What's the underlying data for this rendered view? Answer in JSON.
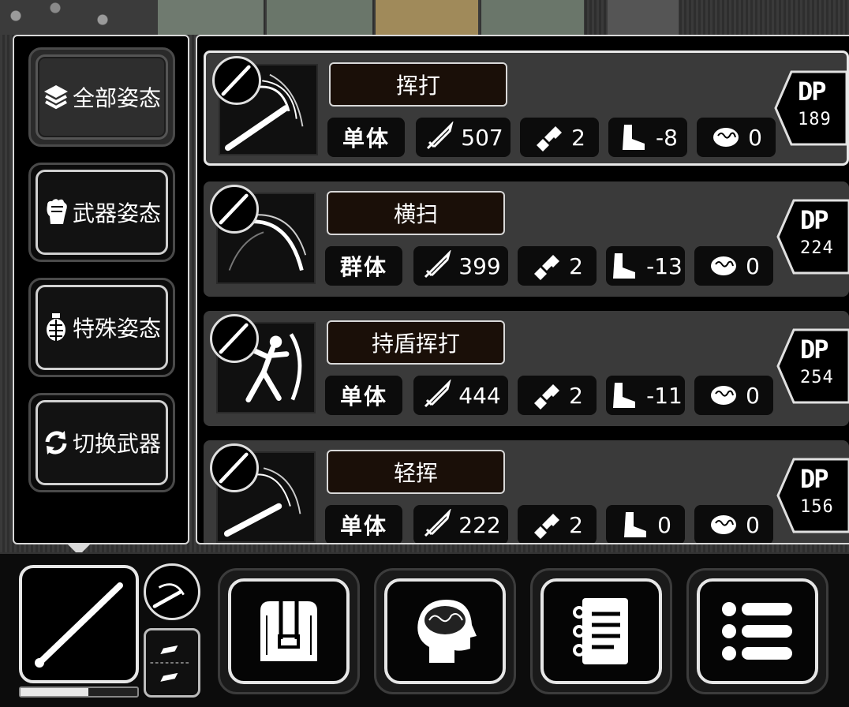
{
  "stances": [
    {
      "label": "全部姿态",
      "icon": "layers-icon",
      "selected": true
    },
    {
      "label": "武器姿态",
      "icon": "fist-icon",
      "selected": false
    },
    {
      "label": "特殊姿态",
      "icon": "grenade-icon",
      "selected": false
    },
    {
      "label": "切换武器",
      "icon": "swap-icon",
      "selected": false
    }
  ],
  "skills": [
    {
      "name": "挥打",
      "target": "单体",
      "attack": "507",
      "speed": "2",
      "move": "-8",
      "mind": "0",
      "dp_label": "DP",
      "dp": "189",
      "art": "swing-icon",
      "selected": true
    },
    {
      "name": "横扫",
      "target": "群体",
      "attack": "399",
      "speed": "2",
      "move": "-13",
      "mind": "0",
      "dp_label": "DP",
      "dp": "224",
      "art": "sweep-icon",
      "selected": false
    },
    {
      "name": "持盾挥打",
      "target": "单体",
      "attack": "444",
      "speed": "2",
      "move": "-11",
      "mind": "0",
      "dp_label": "DP",
      "dp": "254",
      "art": "shield-swing-icon",
      "selected": false
    },
    {
      "name": "轻挥",
      "target": "单体",
      "attack": "222",
      "speed": "2",
      "move": "0",
      "mind": "0",
      "dp_label": "DP",
      "dp": "156",
      "art": "light-swing-icon",
      "selected": false
    }
  ],
  "bottom_bar": {
    "equipped_weapon": "baseball-bat-icon",
    "health_fraction": 0.58,
    "buttons": [
      "backpack-icon",
      "brain-icon",
      "notebook-icon",
      "menu-list-icon"
    ]
  },
  "colors": {
    "panel_bg": "#000000",
    "card_bg": "#3a3a3a",
    "border": "#d8d8d8",
    "skill_name_bg": "#1a0f08"
  }
}
